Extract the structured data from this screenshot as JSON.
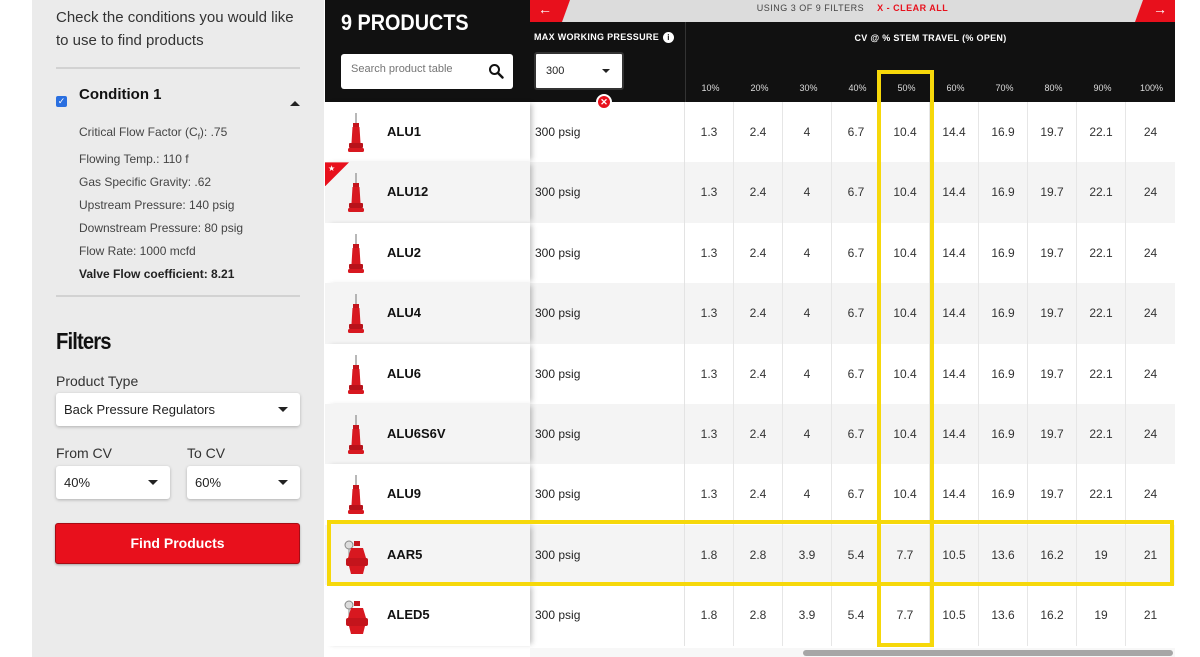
{
  "sidebar": {
    "intro": "Check the conditions you would like to use to find products",
    "condition": {
      "checked": true,
      "title": "Condition 1",
      "lines": [
        "Critical Flow Factor (Cⁱ): .75",
        "Flowing Temp.: 110 f",
        "Gas Specific Gravity: .62",
        "Upstream Pressure: 140 psig",
        "Downstream Pressure: 80 psig",
        "Flow Rate: 1000 mcfd"
      ],
      "cff_prefix": "Critical Flow Factor (C",
      "cff_sub": "f",
      "cff_suffix": "): .75",
      "summary": "Valve Flow coefficient: 8.21"
    },
    "filters": {
      "title": "Filters",
      "product_type_label": "Product Type",
      "product_type_value": "Back Pressure Regulators",
      "from_cv_label": "From CV",
      "from_cv_value": "40%",
      "to_cv_label": "To CV",
      "to_cv_value": "60%",
      "find_button": "Find Products"
    }
  },
  "table": {
    "count_label": "9 PRODUCTS",
    "search_placeholder": "Search product table",
    "filter_status": "USING 3 OF 9 FILTERS",
    "clear_all": "X - CLEAR ALL",
    "max_working_pressure": {
      "label": "MAX WORKING PRESSURE",
      "info": "i",
      "selected": "300"
    },
    "cv_title": "CV @ % STEM TRAVEL (% OPEN)",
    "cv_columns": [
      "10%",
      "20%",
      "30%",
      "40%",
      "50%",
      "60%",
      "70%",
      "80%",
      "90%",
      "100%"
    ],
    "highlight_column": "50%",
    "highlight_row": "AAR5",
    "rows": [
      {
        "name": "ALU1",
        "mwp": "300 psig",
        "featured": false,
        "cv": [
          "1.3",
          "2.4",
          "4",
          "6.7",
          "10.4",
          "14.4",
          "16.9",
          "19.7",
          "22.1",
          "24"
        ]
      },
      {
        "name": "ALU12",
        "mwp": "300 psig",
        "featured": true,
        "cv": [
          "1.3",
          "2.4",
          "4",
          "6.7",
          "10.4",
          "14.4",
          "16.9",
          "19.7",
          "22.1",
          "24"
        ]
      },
      {
        "name": "ALU2",
        "mwp": "300 psig",
        "featured": false,
        "cv": [
          "1.3",
          "2.4",
          "4",
          "6.7",
          "10.4",
          "14.4",
          "16.9",
          "19.7",
          "22.1",
          "24"
        ]
      },
      {
        "name": "ALU4",
        "mwp": "300 psig",
        "featured": false,
        "cv": [
          "1.3",
          "2.4",
          "4",
          "6.7",
          "10.4",
          "14.4",
          "16.9",
          "19.7",
          "22.1",
          "24"
        ]
      },
      {
        "name": "ALU6",
        "mwp": "300 psig",
        "featured": false,
        "cv": [
          "1.3",
          "2.4",
          "4",
          "6.7",
          "10.4",
          "14.4",
          "16.9",
          "19.7",
          "22.1",
          "24"
        ]
      },
      {
        "name": "ALU6S6V",
        "mwp": "300 psig",
        "featured": false,
        "cv": [
          "1.3",
          "2.4",
          "4",
          "6.7",
          "10.4",
          "14.4",
          "16.9",
          "19.7",
          "22.1",
          "24"
        ]
      },
      {
        "name": "ALU9",
        "mwp": "300 psig",
        "featured": false,
        "cv": [
          "1.3",
          "2.4",
          "4",
          "6.7",
          "10.4",
          "14.4",
          "16.9",
          "19.7",
          "22.1",
          "24"
        ]
      },
      {
        "name": "AAR5",
        "mwp": "300 psig",
        "featured": false,
        "cv": [
          "1.8",
          "2.8",
          "3.9",
          "5.4",
          "7.7",
          "10.5",
          "13.6",
          "16.2",
          "19",
          "21"
        ]
      },
      {
        "name": "ALED5",
        "mwp": "300 psig",
        "featured": false,
        "cv": [
          "1.8",
          "2.8",
          "3.9",
          "5.4",
          "7.7",
          "10.5",
          "13.6",
          "16.2",
          "19",
          "21"
        ]
      }
    ]
  },
  "colors": {
    "brand_red": "#e8101c",
    "highlight_yellow": "#f6d80a",
    "header_black": "#111111",
    "sidebar_bg": "#ebebeb",
    "checkbox_blue": "#2a6fe0"
  }
}
